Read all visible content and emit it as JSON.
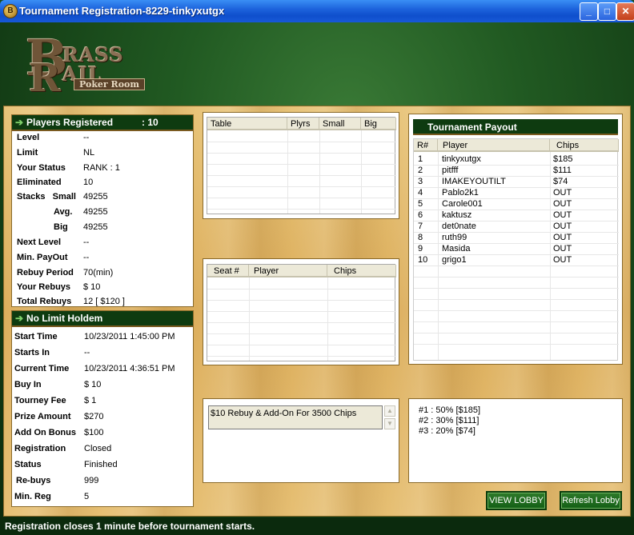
{
  "window": {
    "title": "Tournament Registration-8229-tinkyxutgx",
    "icon_glyph": "B",
    "minimize": "_",
    "maximize": "□",
    "close": "✕"
  },
  "logo": {
    "letter_b": "B",
    "letter_r": "R",
    "brass": "RASS",
    "rail": "AIL",
    "poker_room": "Poker Room"
  },
  "players_panel": {
    "title": "Players Registered",
    "count": ": 10",
    "rows": [
      {
        "label": "Level",
        "value": "--"
      },
      {
        "label": "Limit",
        "value": "NL"
      },
      {
        "label": "Your Status",
        "value": "RANK : 1"
      },
      {
        "label": "Eliminated",
        "value": "10"
      },
      {
        "label": "Stacks   Small",
        "value": "49255"
      },
      {
        "label": "Avg.",
        "value": "49255"
      },
      {
        "label": "Big",
        "value": "49255"
      },
      {
        "label": "Next Level",
        "value": "--"
      },
      {
        "label": "Min. PayOut",
        "value": "--"
      },
      {
        "label": "Rebuy Period",
        "value": "70(min)"
      },
      {
        "label": "Your Rebuys",
        "value": "$ 10"
      },
      {
        "label": "Total Rebuys",
        "value": "12 [ $120 ]"
      }
    ]
  },
  "game_panel": {
    "title": "No Limit Holdem",
    "rows": [
      {
        "label": "Start Time",
        "value": "10/23/2011 1:45:00 PM"
      },
      {
        "label": "Starts In",
        "value": "--"
      },
      {
        "label": "Current Time",
        "value": "10/23/2011 4:36:51 PM"
      },
      {
        "label": "Buy In",
        "value": "$ 10"
      },
      {
        "label": "Tourney Fee",
        "value": "$ 1"
      },
      {
        "label": "Prize Amount",
        "value": "$270"
      },
      {
        "label": "Add On Bonus",
        "value": "$100"
      },
      {
        "label": "Registration",
        "value": "Closed"
      },
      {
        "label": "Status",
        "value": "Finished"
      },
      {
        "label": "Re-buys",
        "value": "999"
      },
      {
        "label": "Min. Reg",
        "value": "5"
      }
    ]
  },
  "tables_grid": {
    "columns": [
      "Table",
      "Plyrs",
      "Small",
      "Big"
    ]
  },
  "seats_grid": {
    "columns": [
      "Seat #",
      "Player",
      "Chips"
    ]
  },
  "payout_panel": {
    "title": "Tournament Payout",
    "columns": [
      "R#",
      "Player",
      "Chips"
    ],
    "rows": [
      {
        "rank": "1",
        "player": "tinkyxutgx",
        "chips": "$185"
      },
      {
        "rank": "2",
        "player": "pitfff",
        "chips": "$111"
      },
      {
        "rank": "3",
        "player": "IMAKEYOUTILT",
        "chips": "$74"
      },
      {
        "rank": "4",
        "player": "Pablo2k1",
        "chips": "OUT"
      },
      {
        "rank": "5",
        "player": "Carole001",
        "chips": "OUT"
      },
      {
        "rank": "6",
        "player": "kaktusz",
        "chips": "OUT"
      },
      {
        "rank": "7",
        "player": "det0nate",
        "chips": "OUT"
      },
      {
        "rank": "8",
        "player": "ruth99",
        "chips": "OUT"
      },
      {
        "rank": "9",
        "player": "Masida",
        "chips": "OUT"
      },
      {
        "rank": "10",
        "player": "grigo1",
        "chips": "OUT"
      }
    ]
  },
  "rebuy_info": {
    "text": "$10 Rebuy & Add-On For 3500 Chips"
  },
  "prize_split": {
    "lines": [
      "#1 : 50% [$185]",
      "#2 : 30% [$111]",
      "#3 : 20% [$74]"
    ]
  },
  "buttons": {
    "view_lobby": "VIEW LOBBY",
    "refresh_lobby": "Refresh Lobby"
  },
  "status_bar": {
    "text": "Registration closes 1 minute before tournament starts."
  }
}
